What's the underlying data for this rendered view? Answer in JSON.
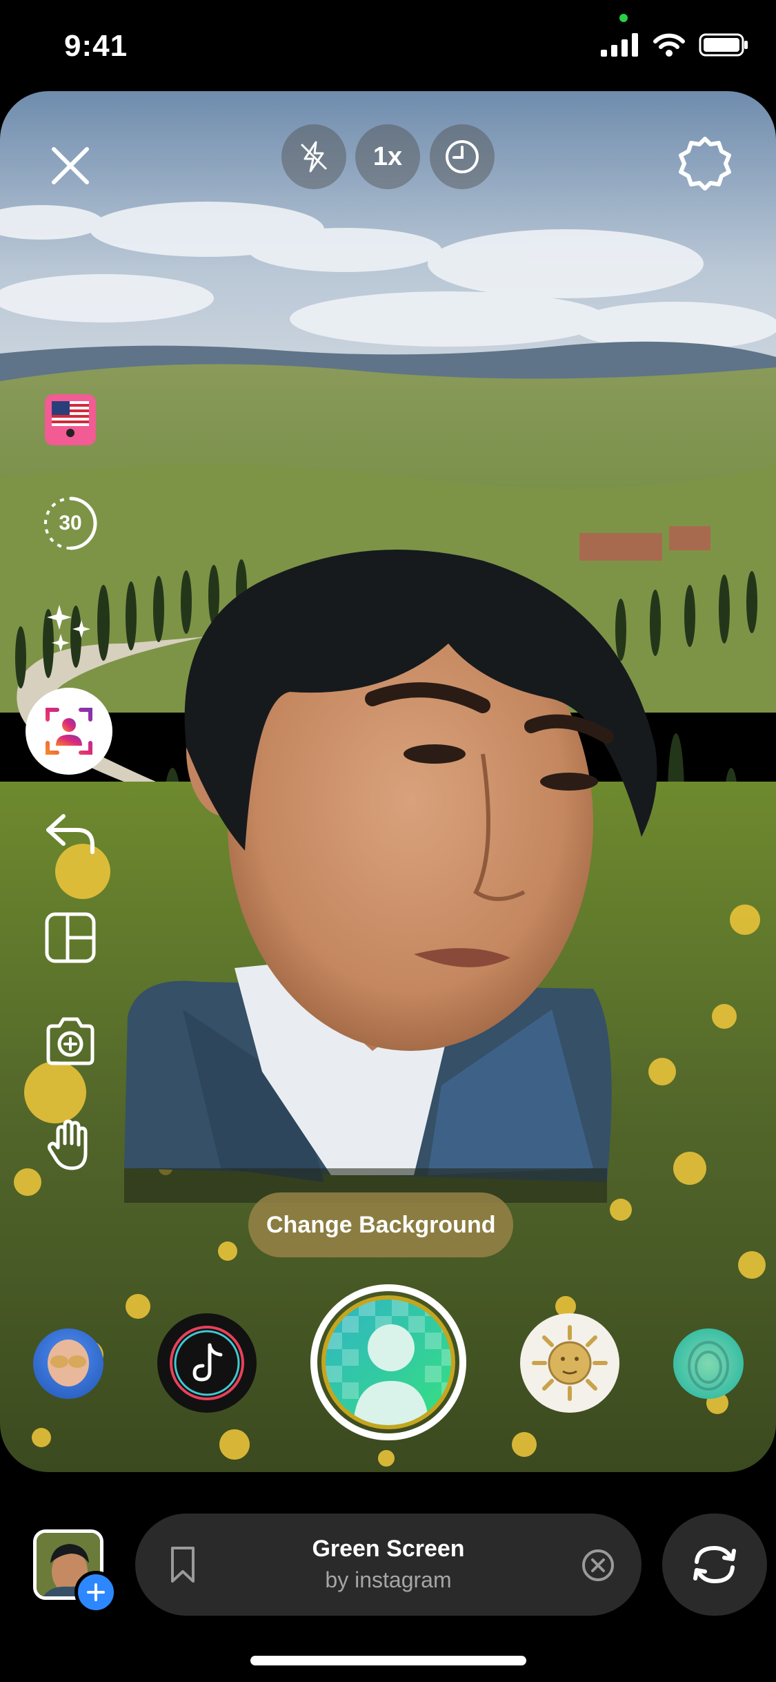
{
  "status_bar": {
    "time": "9:41"
  },
  "camera": {
    "top_controls": {
      "zoom_label": "1x"
    },
    "left_rail": {
      "countdown_label": "30"
    },
    "change_background_label": "Change Background"
  },
  "effect_bar": {
    "effect_name": "Green Screen",
    "effect_author": "by instagram"
  },
  "colors": {
    "accent_blue": "#2d88ff",
    "pill_background": "#2a2a2a",
    "change_background_pill": "#968246",
    "green_screen": "#2ed09a"
  },
  "icons": [
    "close-icon",
    "flash-off-icon",
    "timer-icon",
    "settings-icon",
    "flag-sticker-icon",
    "countdown-icon",
    "sparkles-icon",
    "green-screen-icon",
    "undo-icon",
    "layout-icon",
    "add-photo-icon",
    "hands-free-icon",
    "bookmark-icon",
    "clear-icon",
    "flip-camera-icon"
  ]
}
